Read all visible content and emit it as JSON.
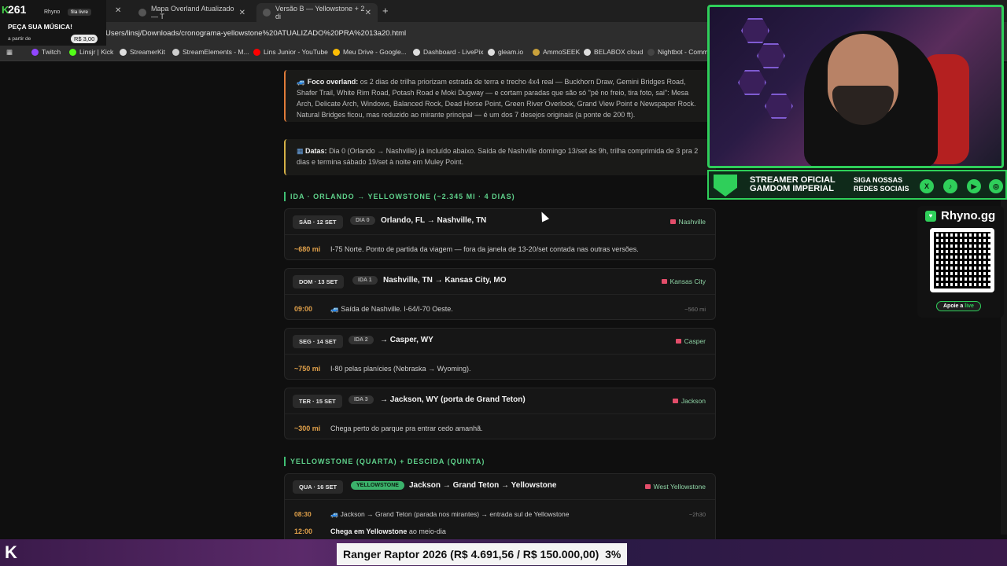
{
  "browser": {
    "tabs": [
      {
        "title": "Mapa Overland Atualizado — T"
      },
      {
        "title": "Versão B — Yellowstone + 2 di"
      }
    ],
    "url": "Users/linsj/Downloads/cronograma-yellowstone%20ATUALIZADO%20PRA%2013a20.html",
    "bookmarks": [
      "Twitch",
      "Linsjr | Kick",
      "StreamerKit",
      "StreamElements - M...",
      "Lins Junior - YouTube",
      "Meu Drive - Google...",
      "Dashboard - LivePix",
      "gleam.io",
      "AmmoSEEK",
      "BELABOX cloud",
      "Nightbot - Comm"
    ]
  },
  "stream_overlay": {
    "viewer_count": "261",
    "channel": "Rhyno",
    "queue_label": "fila livre",
    "request_title": "PEÇA SUA MÚSICA!",
    "from_label": "a partir de",
    "price": "R$ 3,00",
    "banner_line1": "STREAMER OFICIAL",
    "banner_line2": "GAMDOM IMPERIAL",
    "banner_line3": "SIGA NOSSAS",
    "banner_line4": "REDES SOCIAIS",
    "rhyno_name": "Rhyno.gg",
    "apoie_prefix": "Apoie a",
    "apoie_suffix": "live",
    "goal_text": "Ranger Raptor 2026 (R$ 4.691,56 / R$ 150.000,00)",
    "goal_percent": "3%",
    "colors": {
      "accent": "#2fcf5a"
    }
  },
  "page": {
    "foco": {
      "label": "Foco overland:",
      "text": "os 2 dias de trilha priorizam estrada de terra e trecho 4x4 real — Buckhorn Draw, Gemini Bridges Road, Shafer Trail, White Rim Road, Potash Road e Moki Dugway — e cortam paradas que são só \"pé no freio, tira foto, sai\": Mesa Arch, Delicate Arch, Windows, Balanced Rock, Dead Horse Point, Green River Overlook, Grand View Point e Newspaper Rock. Natural Bridges ficou, mas reduzido ao mirante principal — é um dos 7 desejos originais (a ponte de 200 ft)."
    },
    "datas": {
      "label": "Datas:",
      "text": "Dia 0 (Orlando → Nashville) já incluído abaixo. Saída de Nashville domingo 13/set às 9h, trilha comprimida de 3 pra 2 dias e termina sábado 19/set à noite em Muley Point."
    },
    "section1": "IDA · ORLANDO → YELLOWSTONE (~2.345 MI · 4 DIAS)",
    "section2": "YELLOWSTONE (QUARTA) + DESCIDA (QUINTA)",
    "cards": [
      {
        "date": "SÁB · 12 SET",
        "pill": "DIA 0",
        "route": "Orlando, FL → Nashville, TN",
        "dest": "Nashville",
        "rows": [
          {
            "k": "~680 mi",
            "text": "I-75 Norte. Ponto de partida da viagem — fora da janela de 13-20/set contada nas outras versões.",
            "r": ""
          }
        ]
      },
      {
        "date": "DOM · 13 SET",
        "pill": "IDA 1",
        "route": "Nashville, TN → Kansas City, MO",
        "dest": "Kansas City",
        "rows": [
          {
            "k": "09:00",
            "text": "Saída de Nashville. I-64/I-70 Oeste.",
            "r": "~560 mi"
          }
        ]
      },
      {
        "date": "SEG · 14 SET",
        "pill": "IDA 2",
        "route": "→ Casper, WY",
        "dest": "Casper",
        "rows": [
          {
            "k": "~750 mi",
            "text": "I-80 pelas planícies (Nebraska → Wyoming).",
            "r": ""
          }
        ]
      },
      {
        "date": "TER · 15 SET",
        "pill": "IDA 3",
        "route": "→ Jackson, WY (porta de Grand Teton)",
        "dest": "Jackson",
        "rows": [
          {
            "k": "~300 mi",
            "text": "Chega perto do parque pra entrar cedo amanhã.",
            "r": ""
          }
        ]
      },
      {
        "date": "QUA · 16 SET",
        "pill": "YELLOWSTONE",
        "route": "Jackson → Grand Teton → Yellowstone",
        "dest": "West Yellowstone",
        "rows": [
          {
            "k": "08:30",
            "text": "Jackson → Grand Teton (parada nos mirantes) → entrada sul de Yellowstone",
            "r": "~2h30"
          },
          {
            "k": "12:00",
            "text_bold": "Chega em Yellowstone",
            "text": " ao meio-dia",
            "r": ""
          }
        ]
      }
    ]
  }
}
